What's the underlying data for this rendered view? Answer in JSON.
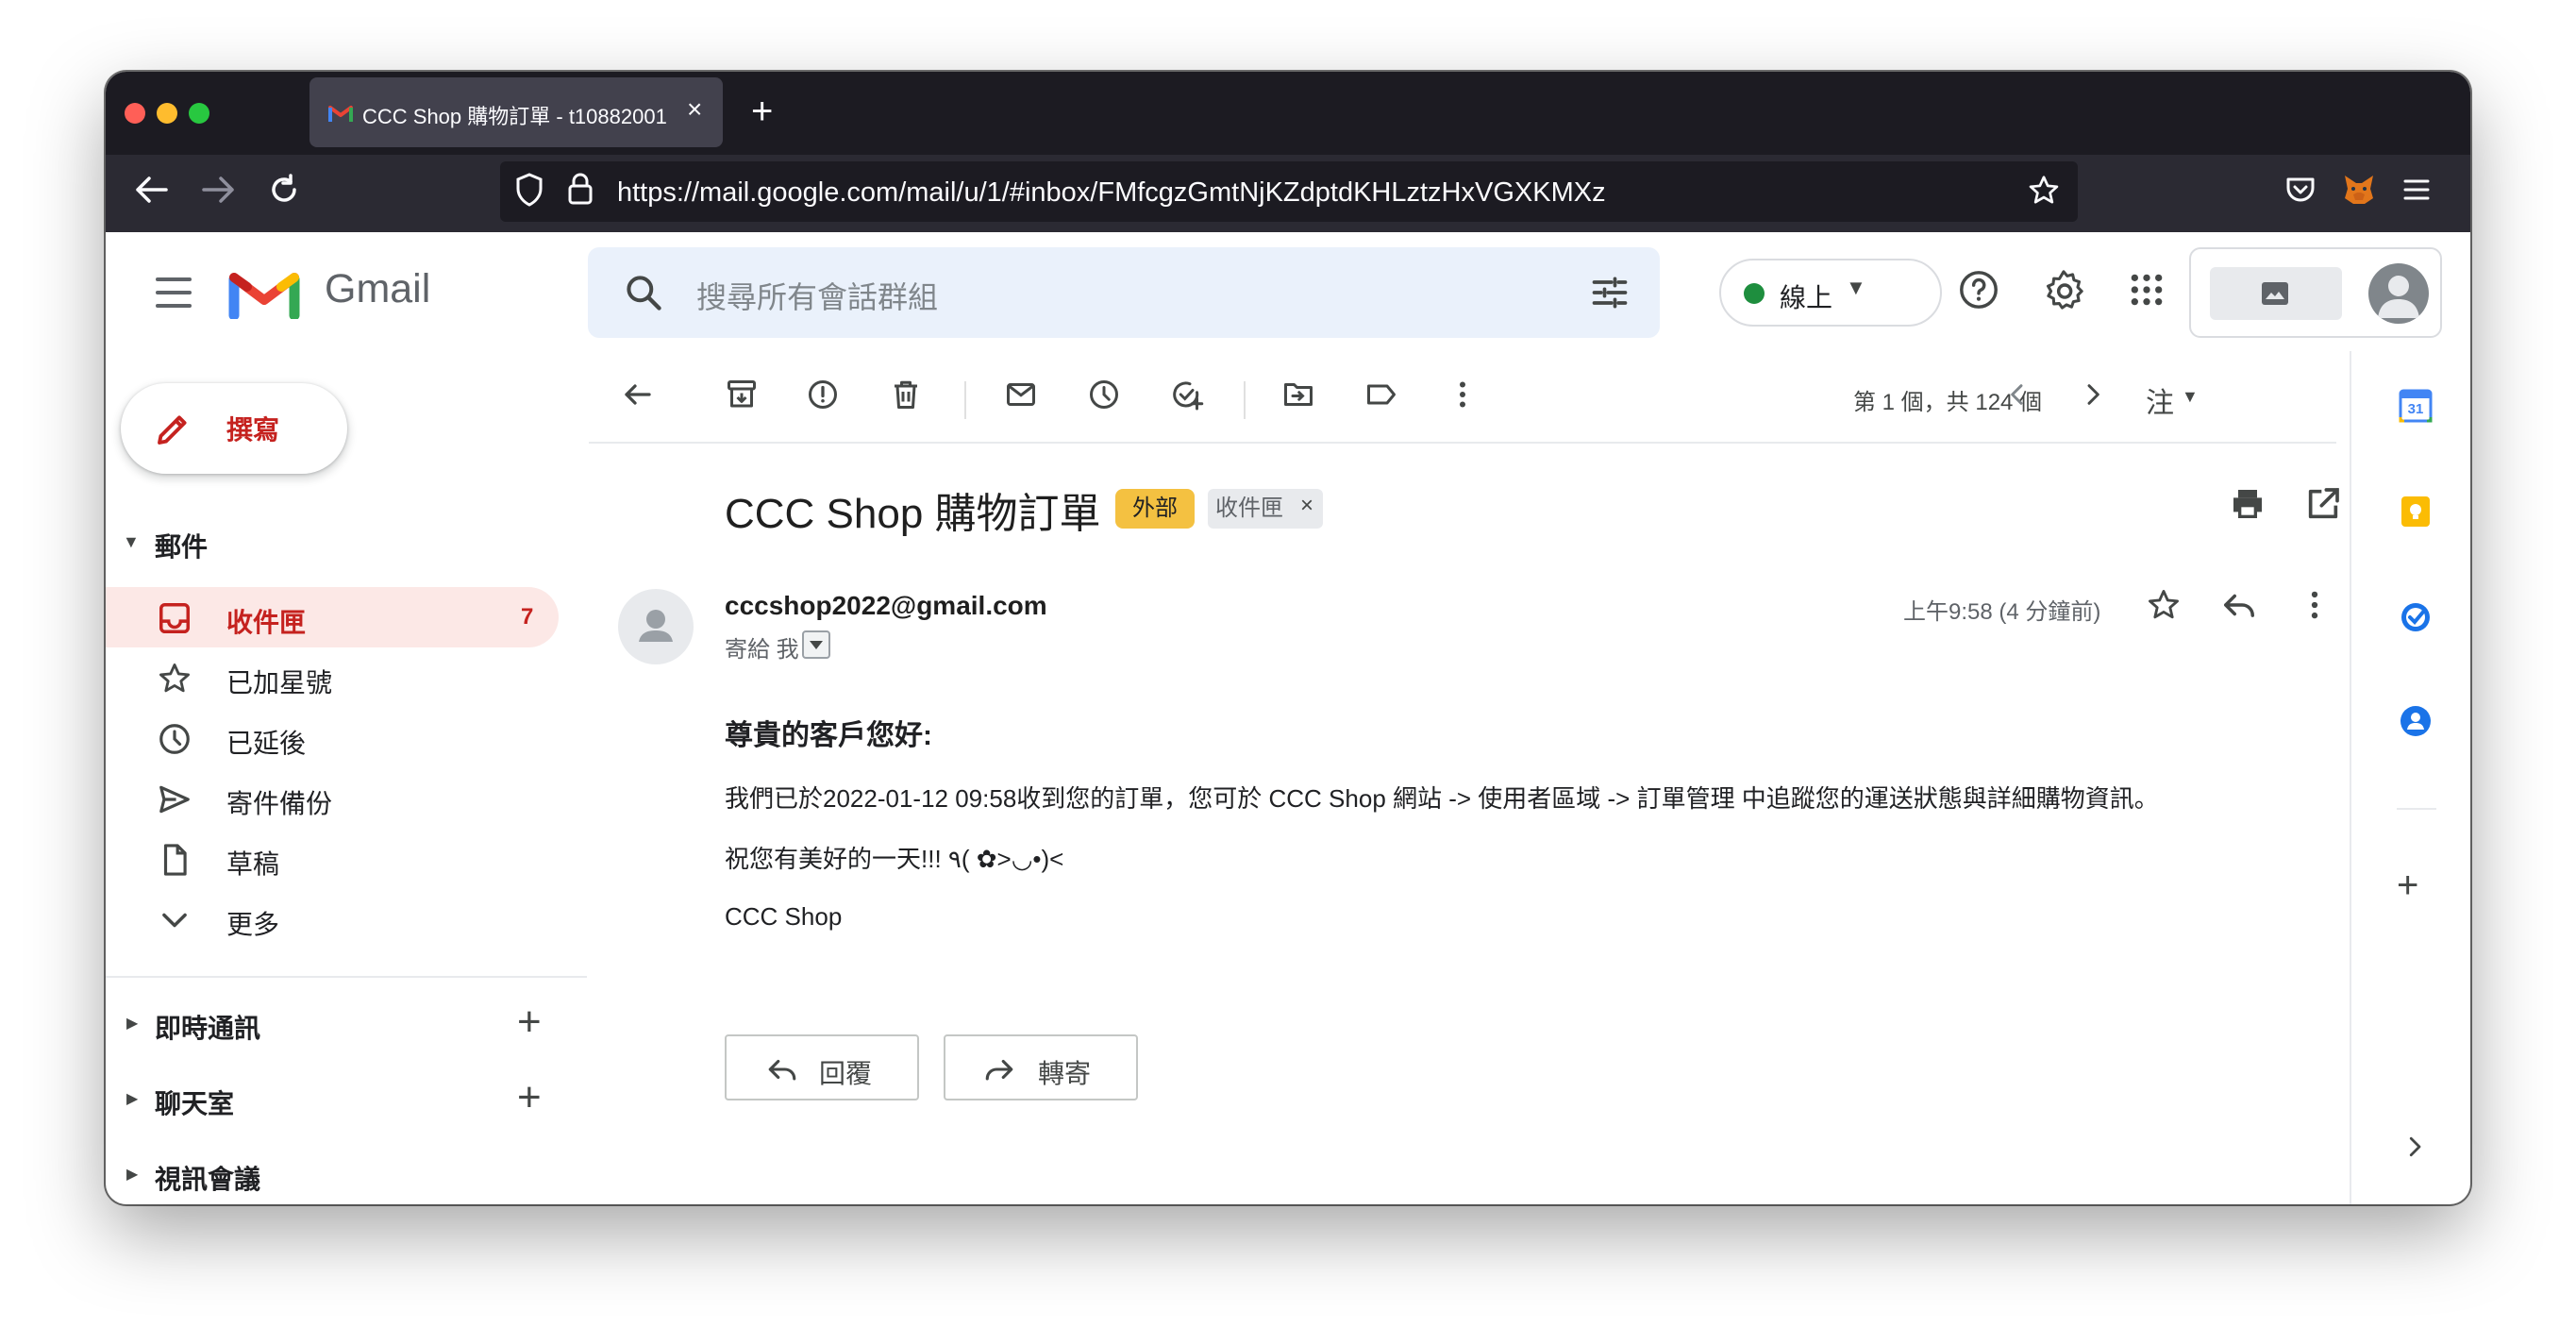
{
  "browser": {
    "tab_title": "CCC Shop 購物訂單 - t10882001",
    "url": "https://mail.google.com/mail/u/1/#inbox/FMfcgzGmtNjKZdptdKHLztzHxVGXKMXz",
    "icons": [
      "back-icon",
      "forward-icon",
      "reload-icon",
      "shield-icon",
      "lock-icon",
      "bookmark-star-icon",
      "pocket-icon",
      "metamask-icon",
      "menu-icon"
    ]
  },
  "gmail": {
    "logo_text": "Gmail",
    "search_placeholder": "搜尋所有會話群組",
    "status": "線上",
    "status_color": "#1e8e3e"
  },
  "sidebar": {
    "compose": "撰寫",
    "mail_section": "郵件",
    "items": [
      {
        "label": "收件匣",
        "count": "7",
        "icon": "inbox-icon",
        "active": true
      },
      {
        "label": "已加星號",
        "icon": "star-icon"
      },
      {
        "label": "已延後",
        "icon": "clock-icon"
      },
      {
        "label": "寄件備份",
        "icon": "send-icon"
      },
      {
        "label": "草稿",
        "icon": "draft-icon"
      },
      {
        "label": "更多",
        "icon": "chevron-down-icon"
      }
    ],
    "sections": [
      {
        "label": "即時通訊"
      },
      {
        "label": "聊天室"
      },
      {
        "label": "視訊會議"
      }
    ]
  },
  "toolbar": {
    "pagination": "第 1 個，共 124 個",
    "input_tools": "注"
  },
  "message": {
    "subject": "CCC Shop 購物訂單",
    "badge_external": "外部",
    "badge_inbox": "收件匣",
    "sender": "cccshop2022@gmail.com",
    "to": "寄給 我",
    "time": "上午9:58 (4 分鐘前)",
    "greeting": "尊貴的客戶您好:",
    "body_line": "我們已於2022-01-12 09:58收到您的訂單，您可於 CCC Shop 網站 -> 使用者區域 -> 訂單管理 中追蹤您的運送狀態與詳細購物資訊。",
    "wish": "祝您有美好的一天!!! ٩( ✿>◡•)<",
    "signature": "CCC Shop",
    "reply": "回覆",
    "forward": "轉寄"
  },
  "side_apps": {
    "calendar_day": "31"
  },
  "colors": {
    "accent_red": "#c5221f",
    "active_bg": "#fce8e6",
    "badge_yellow": "#f4c141"
  }
}
